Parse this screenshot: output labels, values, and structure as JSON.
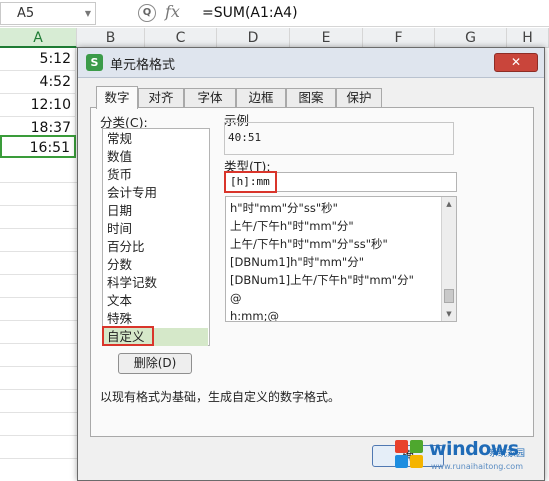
{
  "formula_bar": {
    "name_box": "A5",
    "zoom_glyph": "Q",
    "fx_label": "fx",
    "formula": "=SUM(A1:A4)"
  },
  "columns": [
    "A",
    "B",
    "C",
    "D",
    "E",
    "F",
    "G",
    "H"
  ],
  "cells": [
    "5:12",
    "4:52",
    "12:10",
    "18:37",
    "16:51"
  ],
  "dialog": {
    "title": "单元格格式",
    "app_icon": "S",
    "close_label": "✕",
    "tabs": [
      "数字",
      "对齐",
      "字体",
      "边框",
      "图案",
      "保护"
    ],
    "category_label": "分类(C):",
    "categories": [
      "常规",
      "数值",
      "货币",
      "会计专用",
      "日期",
      "时间",
      "百分比",
      "分数",
      "科学记数",
      "文本",
      "特殊",
      "自定义"
    ],
    "selected_category": "自定义",
    "example_label": "示例",
    "example_value": "40:51",
    "type_label": "类型(T):",
    "type_value": "[h]:mm",
    "format_list": [
      "h\"时\"mm\"分\"ss\"秒\"",
      "上午/下午h\"时\"mm\"分\"",
      "上午/下午h\"时\"mm\"分\"ss\"秒\"",
      "[DBNum1]h\"时\"mm\"分\"",
      "[DBNum1]上午/下午h\"时\"mm\"分\"",
      "@",
      "h:mm;@"
    ],
    "delete_button": "删除(D)",
    "description": "以现有格式为基础，生成自定义的数字格式。",
    "ok_button": "确"
  },
  "watermark": {
    "brand": "windows",
    "sub": "系统家园",
    "url": "www.runaihaitong.com",
    "colors": [
      "#e8412c",
      "#4ea72e",
      "#1c8de0",
      "#f5b400"
    ]
  }
}
